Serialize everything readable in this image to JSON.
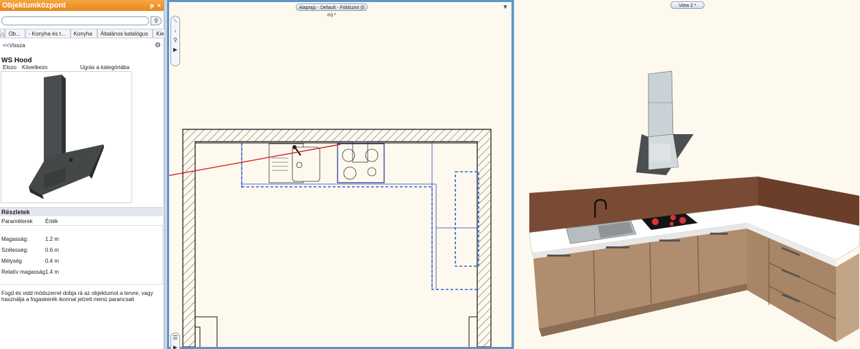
{
  "panel": {
    "title": "Objektumközpont",
    "pin_icon": "pin-icon",
    "close_icon": "close-icon",
    "search": {
      "value": "",
      "icon": "search-icon"
    },
    "breadcrumbs": [
      "Ob...",
      "- Konyha és t...",
      "Konyha",
      "Általános katalógus",
      "Kieg"
    ],
    "back_label": "<<Vissza",
    "object_name": "WS Hood",
    "nav": {
      "prev": "Elozo",
      "next": "Következo",
      "jump": "Ugrás a kategóriába"
    },
    "details": {
      "header": "Részletek",
      "col_param": "Paraméterek",
      "col_value": "Érték",
      "rows": [
        {
          "name": "Magasság:",
          "value": "1.2 m"
        },
        {
          "name": "Szélesség:",
          "value": "0.6 m"
        },
        {
          "name": "Mélység",
          "value": "0.4 m"
        },
        {
          "name": "Relatív magasság",
          "value": "1.4 m"
        }
      ]
    },
    "hint": "Fogd és vidd módszerrel dobja rá az objektumot a tervre, vagy használja a fogaskerék ikonnal jelzett menü parancsait"
  },
  "plan_view": {
    "tab_label": "Alaprajz - Default - Földszint (0 m) *"
  },
  "view_3d": {
    "tab_label": "View 2 *"
  },
  "colors": {
    "accent": "#5d93c9",
    "title_bar": "#f09a30",
    "drag_line": "#d62020"
  }
}
